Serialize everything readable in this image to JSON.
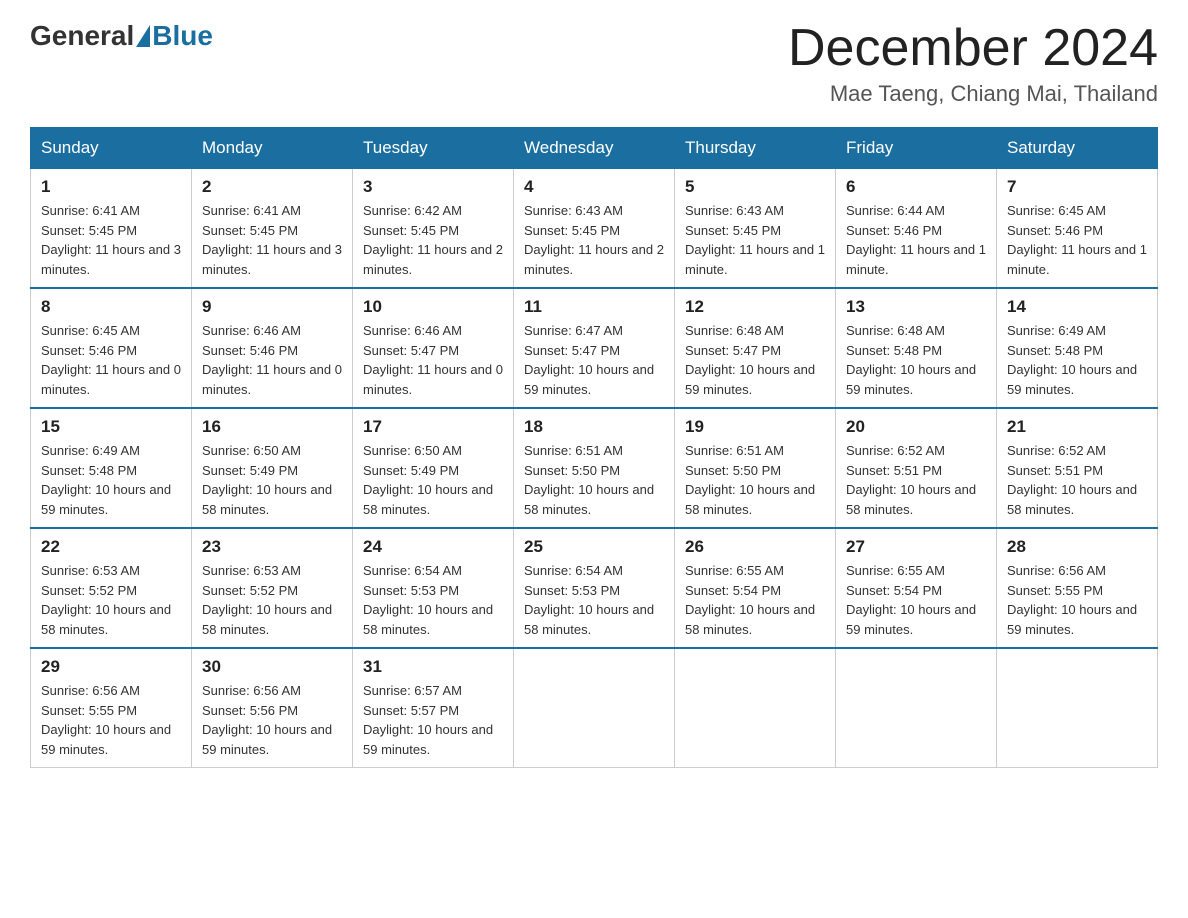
{
  "header": {
    "logo": {
      "general": "General",
      "blue": "Blue"
    },
    "title": "December 2024",
    "location": "Mae Taeng, Chiang Mai, Thailand"
  },
  "calendar": {
    "days_of_week": [
      "Sunday",
      "Monday",
      "Tuesday",
      "Wednesday",
      "Thursday",
      "Friday",
      "Saturday"
    ],
    "weeks": [
      [
        {
          "day": "1",
          "sunrise": "6:41 AM",
          "sunset": "5:45 PM",
          "daylight": "11 hours and 3 minutes."
        },
        {
          "day": "2",
          "sunrise": "6:41 AM",
          "sunset": "5:45 PM",
          "daylight": "11 hours and 3 minutes."
        },
        {
          "day": "3",
          "sunrise": "6:42 AM",
          "sunset": "5:45 PM",
          "daylight": "11 hours and 2 minutes."
        },
        {
          "day": "4",
          "sunrise": "6:43 AM",
          "sunset": "5:45 PM",
          "daylight": "11 hours and 2 minutes."
        },
        {
          "day": "5",
          "sunrise": "6:43 AM",
          "sunset": "5:45 PM",
          "daylight": "11 hours and 1 minute."
        },
        {
          "day": "6",
          "sunrise": "6:44 AM",
          "sunset": "5:46 PM",
          "daylight": "11 hours and 1 minute."
        },
        {
          "day": "7",
          "sunrise": "6:45 AM",
          "sunset": "5:46 PM",
          "daylight": "11 hours and 1 minute."
        }
      ],
      [
        {
          "day": "8",
          "sunrise": "6:45 AM",
          "sunset": "5:46 PM",
          "daylight": "11 hours and 0 minutes."
        },
        {
          "day": "9",
          "sunrise": "6:46 AM",
          "sunset": "5:46 PM",
          "daylight": "11 hours and 0 minutes."
        },
        {
          "day": "10",
          "sunrise": "6:46 AM",
          "sunset": "5:47 PM",
          "daylight": "11 hours and 0 minutes."
        },
        {
          "day": "11",
          "sunrise": "6:47 AM",
          "sunset": "5:47 PM",
          "daylight": "10 hours and 59 minutes."
        },
        {
          "day": "12",
          "sunrise": "6:48 AM",
          "sunset": "5:47 PM",
          "daylight": "10 hours and 59 minutes."
        },
        {
          "day": "13",
          "sunrise": "6:48 AM",
          "sunset": "5:48 PM",
          "daylight": "10 hours and 59 minutes."
        },
        {
          "day": "14",
          "sunrise": "6:49 AM",
          "sunset": "5:48 PM",
          "daylight": "10 hours and 59 minutes."
        }
      ],
      [
        {
          "day": "15",
          "sunrise": "6:49 AM",
          "sunset": "5:48 PM",
          "daylight": "10 hours and 59 minutes."
        },
        {
          "day": "16",
          "sunrise": "6:50 AM",
          "sunset": "5:49 PM",
          "daylight": "10 hours and 58 minutes."
        },
        {
          "day": "17",
          "sunrise": "6:50 AM",
          "sunset": "5:49 PM",
          "daylight": "10 hours and 58 minutes."
        },
        {
          "day": "18",
          "sunrise": "6:51 AM",
          "sunset": "5:50 PM",
          "daylight": "10 hours and 58 minutes."
        },
        {
          "day": "19",
          "sunrise": "6:51 AM",
          "sunset": "5:50 PM",
          "daylight": "10 hours and 58 minutes."
        },
        {
          "day": "20",
          "sunrise": "6:52 AM",
          "sunset": "5:51 PM",
          "daylight": "10 hours and 58 minutes."
        },
        {
          "day": "21",
          "sunrise": "6:52 AM",
          "sunset": "5:51 PM",
          "daylight": "10 hours and 58 minutes."
        }
      ],
      [
        {
          "day": "22",
          "sunrise": "6:53 AM",
          "sunset": "5:52 PM",
          "daylight": "10 hours and 58 minutes."
        },
        {
          "day": "23",
          "sunrise": "6:53 AM",
          "sunset": "5:52 PM",
          "daylight": "10 hours and 58 minutes."
        },
        {
          "day": "24",
          "sunrise": "6:54 AM",
          "sunset": "5:53 PM",
          "daylight": "10 hours and 58 minutes."
        },
        {
          "day": "25",
          "sunrise": "6:54 AM",
          "sunset": "5:53 PM",
          "daylight": "10 hours and 58 minutes."
        },
        {
          "day": "26",
          "sunrise": "6:55 AM",
          "sunset": "5:54 PM",
          "daylight": "10 hours and 58 minutes."
        },
        {
          "day": "27",
          "sunrise": "6:55 AM",
          "sunset": "5:54 PM",
          "daylight": "10 hours and 59 minutes."
        },
        {
          "day": "28",
          "sunrise": "6:56 AM",
          "sunset": "5:55 PM",
          "daylight": "10 hours and 59 minutes."
        }
      ],
      [
        {
          "day": "29",
          "sunrise": "6:56 AM",
          "sunset": "5:55 PM",
          "daylight": "10 hours and 59 minutes."
        },
        {
          "day": "30",
          "sunrise": "6:56 AM",
          "sunset": "5:56 PM",
          "daylight": "10 hours and 59 minutes."
        },
        {
          "day": "31",
          "sunrise": "6:57 AM",
          "sunset": "5:57 PM",
          "daylight": "10 hours and 59 minutes."
        },
        null,
        null,
        null,
        null
      ]
    ]
  }
}
